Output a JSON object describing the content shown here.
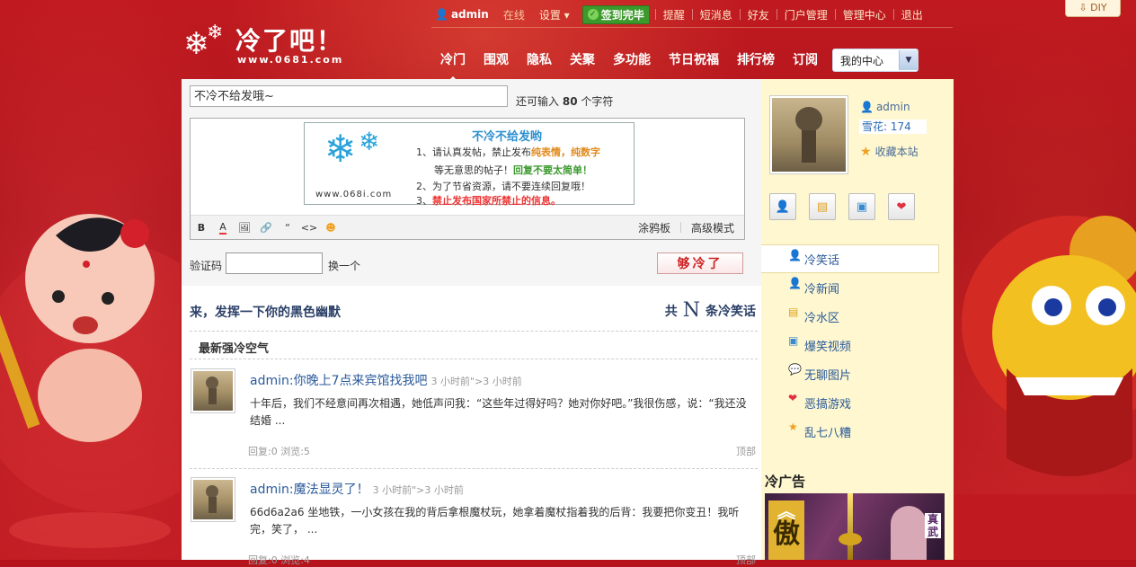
{
  "topbar": {
    "username": "admin",
    "status": "在线",
    "settings": "设置",
    "signed": "签到完毕",
    "links": [
      "提醒",
      "短消息",
      "好友",
      "门户管理",
      "管理中心",
      "退出"
    ]
  },
  "diy": "DIY",
  "logo": {
    "name": "冷了吧！",
    "url": "www.0681.com"
  },
  "nav": {
    "items": [
      "冷门",
      "围观",
      "隐私",
      "关聚",
      "多功能",
      "节日祝福",
      "排行榜",
      "订阅"
    ],
    "my_center": "我的中心"
  },
  "compose": {
    "title_value": "不冷不给发哦~",
    "counter_prefix": "还可输入",
    "counter_num": "80",
    "counter_suffix": "个字符",
    "notice": {
      "site": "www.068i.com",
      "title": "不冷不给发哟",
      "l1a": "1、请认真发帖，禁止发布",
      "l1b": "纯表情，纯数字",
      "l2a": "等无意思的帖子！",
      "l2b": "回复不要太简单！",
      "l3a": "2、为了节省资源，请不要连续回复哦！",
      "l4a": "3、",
      "l4b": "禁止发布国家所禁止的信息。"
    },
    "toolbar": {
      "bold": "B",
      "color": "A",
      "quote": "“",
      "code": "<>",
      "doodle": "涂鸦板",
      "advanced": "高级模式"
    },
    "captcha_label": "验证码",
    "captcha_change": "换一个",
    "submit": "够冷了"
  },
  "list": {
    "heading": "来，发挥一下你的黑色幽默",
    "total_prefix": "共",
    "total_n": "N",
    "total_suffix": "条冷笑话",
    "subheading": "最新强冷空气",
    "posts": [
      {
        "title": "admin:你晚上7点来宾馆找我吧",
        "time": "3 小时前\">3 小时前",
        "body": "十年后，我们不经意间再次相遇，她低声问我：“这些年过得好吗？她对你好吧。”我很伤感，说：“我还没结婚 ...",
        "meta": "回复:0 浏览:5",
        "top": "顶部"
      },
      {
        "title": "admin:魔法显灵了！",
        "time": "3 小时前\">3 小时前",
        "body": "66d6a2a6 坐地铁，一小女孩在我的背后拿根魔杖玩，她拿着魔杖指着我的后背：我要把你变丑！我听完，笑了， ...",
        "meta": "回复:0 浏览:4",
        "top": "顶部"
      }
    ]
  },
  "sidebar": {
    "username": "admin",
    "snow_label": "雪花:",
    "snow_value": "174",
    "favorite": "收藏本站",
    "menu": [
      {
        "label": "冷笑话",
        "icon": "user-icon"
      },
      {
        "label": "冷新闻",
        "icon": "user-icon"
      },
      {
        "label": "冷水区",
        "icon": "doc-icon"
      },
      {
        "label": "爆笑视频",
        "icon": "image-icon"
      },
      {
        "label": "无聊图片",
        "icon": "chat-icon"
      },
      {
        "label": "恶搞游戏",
        "icon": "heart-icon"
      },
      {
        "label": "乱七八糟",
        "icon": "star-icon"
      }
    ],
    "ad_title": "冷广告",
    "ad_big": "傲",
    "ad_tag": "真武",
    "accent": "#2a5a9a"
  }
}
